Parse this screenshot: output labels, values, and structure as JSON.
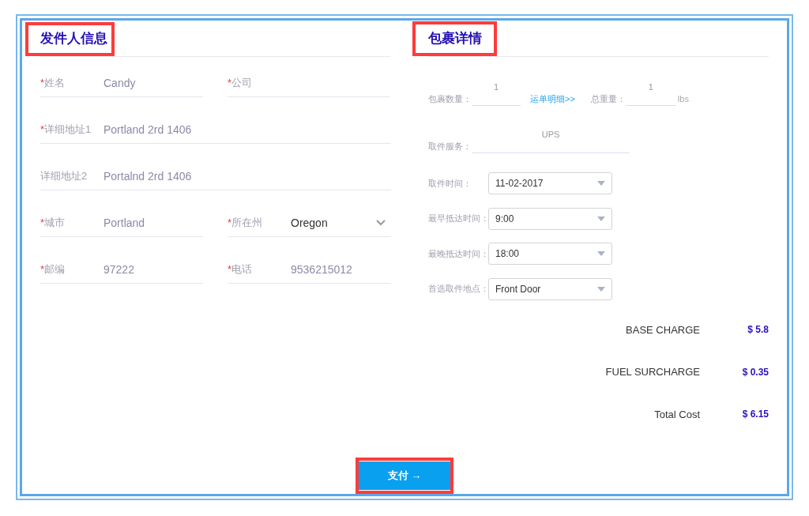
{
  "sender": {
    "title": "发件人信息",
    "highlighted": true,
    "rows": [
      [
        {
          "kind": "text",
          "mark": "*",
          "label": "姓名",
          "value": "Candy"
        },
        {
          "kind": "text",
          "mark": "*",
          "label": "公司"
        }
      ],
      [
        {
          "kind": "text",
          "mark": "*",
          "label": "详细地址1",
          "value": "Portland 2rd 1406"
        }
      ],
      [
        {
          "kind": "text",
          "label": "详细地址2",
          "value": "Portalnd 2rd 1406"
        }
      ],
      [
        {
          "kind": "text",
          "mark": "*",
          "label": "城市",
          "value": "Portland"
        },
        {
          "kind": "select",
          "mark": "*",
          "label": "所在州",
          "value": "Oregon"
        }
      ],
      [
        {
          "kind": "text",
          "mark": "*",
          "label": "邮编",
          "value": "97222"
        },
        {
          "kind": "text",
          "mark": "*",
          "label": "电话",
          "value": "9536215012"
        }
      ]
    ]
  },
  "package": {
    "title": "包裹详情",
    "highlighted": true,
    "quantity": {
      "label": "包裹数量：",
      "value": "1"
    },
    "details_link": "运单明细>>",
    "weight": {
      "label": "总重量：",
      "value": "1",
      "unit": "lbs"
    },
    "service": {
      "label": "取件服务：",
      "value": "UPS"
    },
    "selects": [
      {
        "label": "取件时间：",
        "value": "11-02-2017"
      },
      {
        "label": "最早抵达时间：",
        "value": "9:00"
      },
      {
        "label": "最晚抵达时间：",
        "value": "18:00"
      },
      {
        "label": "首选取件地点：",
        "value": "Front Door"
      }
    ],
    "costs": [
      {
        "label": "BASE CHARGE",
        "value": "$ 5.8"
      },
      {
        "label": "FUEL SURCHARGE",
        "value": "$ 0.35"
      },
      {
        "label": "Total Cost",
        "value": "$ 6.15"
      }
    ]
  },
  "pay_button": {
    "label": "支付 →",
    "highlighted": true
  }
}
